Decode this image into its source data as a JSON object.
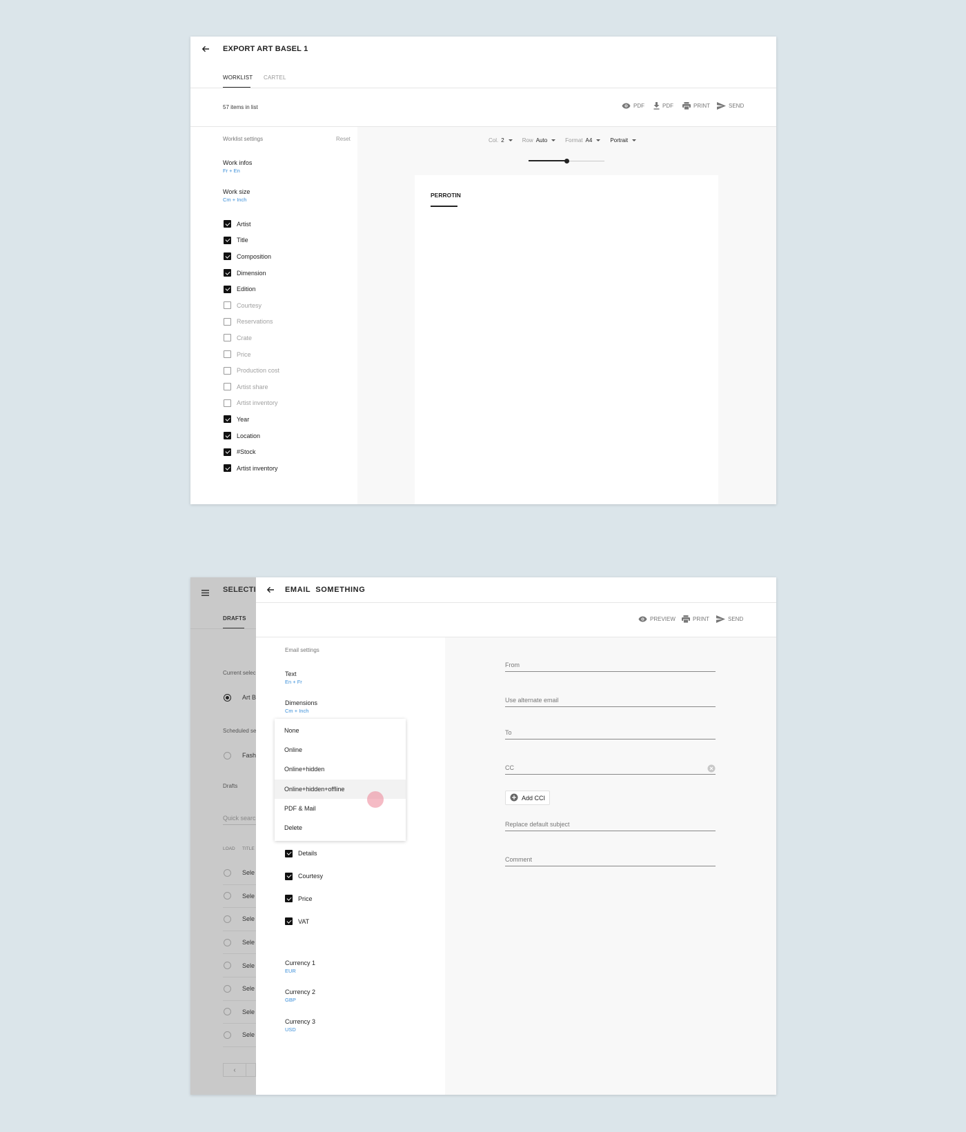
{
  "export_card": {
    "title": "EXPORT ART BASEL 1",
    "tabs": [
      {
        "label": "WORKLIST",
        "active": true
      },
      {
        "label": "CARTEL",
        "active": false
      }
    ],
    "item_count": "57 items in list",
    "actions": [
      {
        "icon": "eye-icon",
        "label": "PDF"
      },
      {
        "icon": "download-icon",
        "label": "PDF"
      },
      {
        "icon": "printer-icon",
        "label": "PRINT"
      },
      {
        "icon": "send-icon",
        "label": "SEND"
      }
    ],
    "settings_title": "Worklist settings",
    "reset_label": "Reset",
    "work_infos": {
      "title": "Work infos",
      "value": "Fr + En"
    },
    "work_size": {
      "title": "Work size",
      "value": "Cm + Inch"
    },
    "fields": [
      {
        "label": "Artist",
        "checked": true
      },
      {
        "label": "Title",
        "checked": true
      },
      {
        "label": "Composition",
        "checked": true
      },
      {
        "label": "Dimension",
        "checked": true
      },
      {
        "label": "Edition",
        "checked": true
      },
      {
        "label": "Courtesy",
        "checked": false
      },
      {
        "label": "Reservations",
        "checked": false
      },
      {
        "label": "Crate",
        "checked": false
      },
      {
        "label": "Price",
        "checked": false
      },
      {
        "label": "Production cost",
        "checked": false
      },
      {
        "label": "Artist share",
        "checked": false
      },
      {
        "label": "Artist inventory",
        "checked": false
      },
      {
        "label": "Year",
        "checked": true
      },
      {
        "label": "Location",
        "checked": true
      },
      {
        "label": "#Stock",
        "checked": true
      },
      {
        "label": "Artist inventory",
        "checked": true
      }
    ],
    "controls": {
      "col_label": "Col.",
      "col_value": "2",
      "row_label": "Row",
      "row_value": "Auto",
      "format_label": "Format",
      "format_value": "A4",
      "orientation_value": "Portrait"
    },
    "zoom_level": 0.5,
    "sheet_brand": "PERROTIN"
  },
  "background_panel": {
    "title": "SELECTI",
    "tab": "DRAFTS",
    "current_section": "Current selec",
    "current_item": "Art B",
    "scheduled_section": "Scheduled se",
    "scheduled_item": "Fash",
    "drafts_section": "Drafts",
    "search_placeholder": "Quick searc",
    "col_load": "LOAD",
    "col_title": "TITLE",
    "rows": [
      "Sele",
      "Sele",
      "Sele",
      "Sele",
      "Sele",
      "Sele",
      "Sele",
      "Sele"
    ],
    "prev_label": "‹"
  },
  "email_card": {
    "title": "EMAIL  SOMETHING",
    "actions": [
      {
        "icon": "eye-icon",
        "label": "PREVIEW"
      },
      {
        "icon": "printer-icon",
        "label": "PRINT"
      },
      {
        "icon": "send-icon",
        "label": "SEND"
      }
    ],
    "settings_title": "Email settings",
    "text_setting": {
      "title": "Text",
      "value": "En + Fr"
    },
    "dimensions_setting": {
      "title": "Dimensions",
      "value": "Cm + Inch"
    },
    "menu_items": [
      "None",
      "Online",
      "Online+hidden",
      "Online+hidden+offline",
      "PDF & Mail",
      "Delete"
    ],
    "highlighted_menu_item": "Online+hidden+offline",
    "options": [
      {
        "label": "Details",
        "checked": true
      },
      {
        "label": "Courtesy",
        "checked": true
      },
      {
        "label": "Price",
        "checked": true
      },
      {
        "label": "VAT",
        "checked": true
      }
    ],
    "currencies": [
      {
        "title": "Currency 1",
        "value": "EUR"
      },
      {
        "title": "Currency 2",
        "value": "GBP"
      },
      {
        "title": "Currency 3",
        "value": "USD"
      }
    ],
    "fields": {
      "from": "From",
      "alternate_email": "Use alternate email",
      "to": "To",
      "cc": "CC",
      "add_cci": "Add CCI",
      "subject": "Replace default subject",
      "comment": "Comment"
    }
  }
}
